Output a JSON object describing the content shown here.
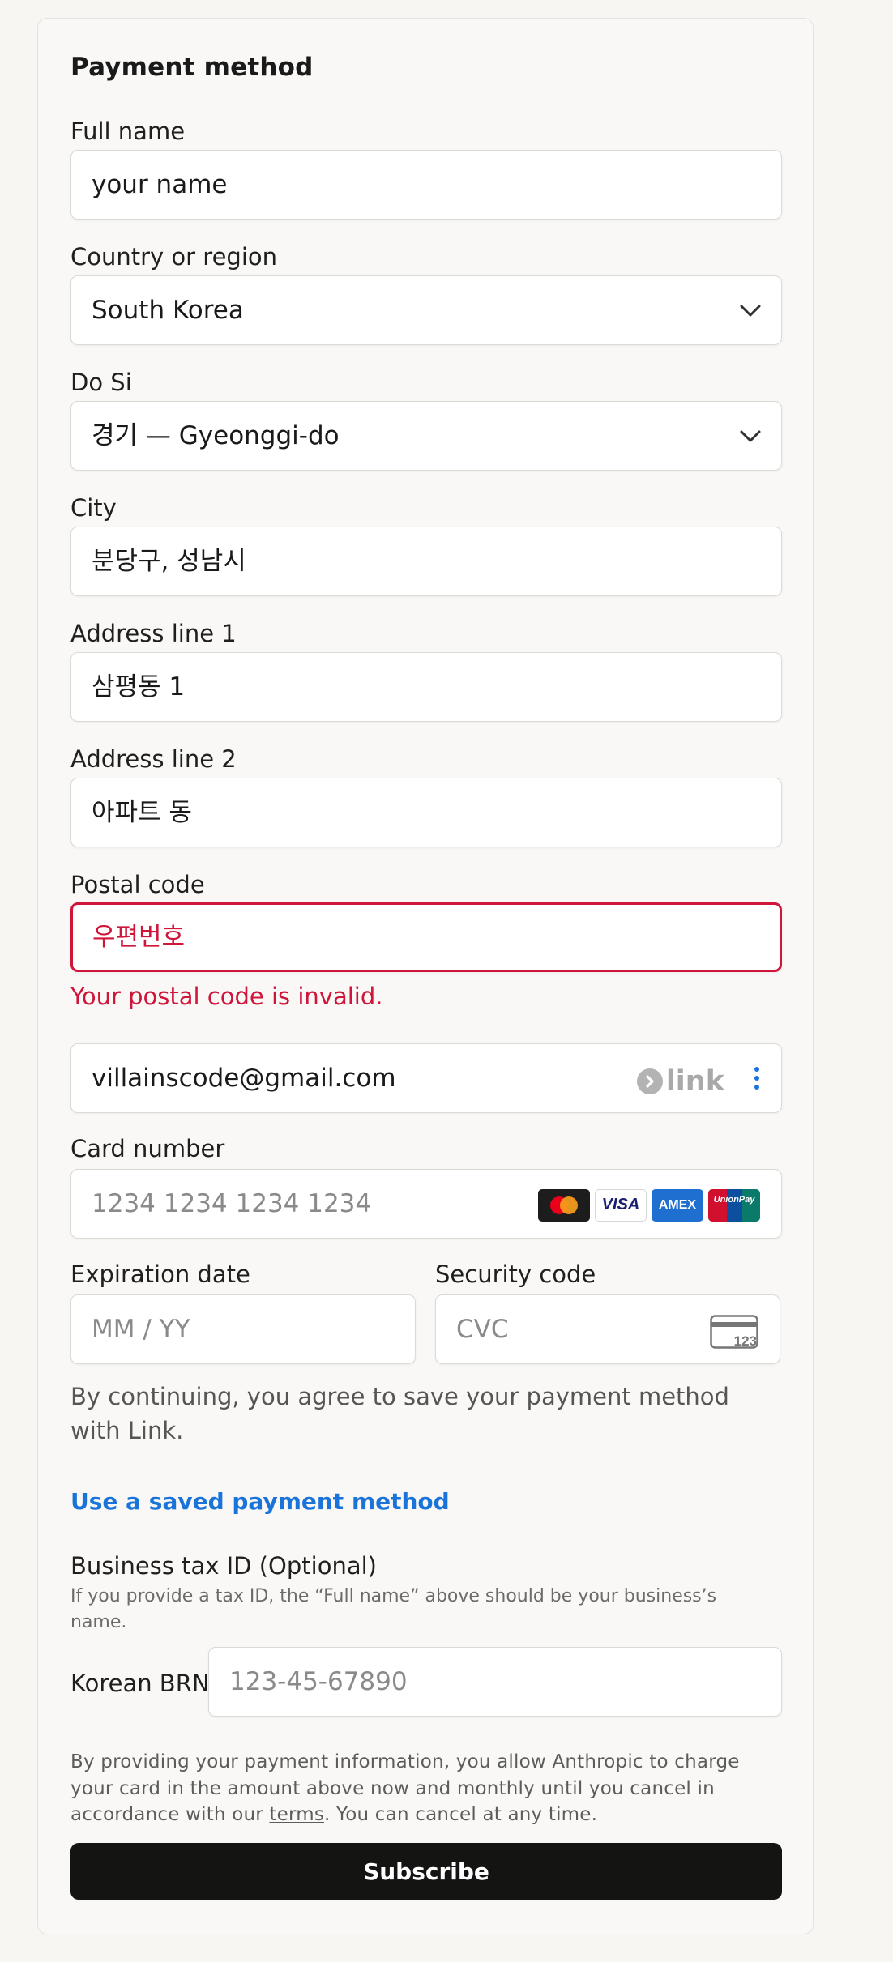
{
  "title": "Payment method",
  "full_name": {
    "label": "Full name",
    "value": "your name"
  },
  "country": {
    "label": "Country or region",
    "value": "South Korea"
  },
  "do_si": {
    "label": "Do Si",
    "value": "경기 — Gyeonggi-do"
  },
  "city": {
    "label": "City",
    "value": "분당구, 성남시"
  },
  "address1": {
    "label": "Address line 1",
    "value": "삼평동 1"
  },
  "address2": {
    "label": "Address line 2",
    "value": "아파트 동"
  },
  "postal": {
    "label": "Postal code",
    "value": "우편번호",
    "error": "Your postal code is invalid."
  },
  "link_email": {
    "value": "villainscode@gmail.com",
    "logo_text": "link"
  },
  "card_number": {
    "label": "Card number",
    "placeholder": "1234 1234 1234 1234",
    "brands": [
      "Mastercard",
      "VISA",
      "AMEX",
      "UnionPay"
    ]
  },
  "expiration": {
    "label": "Expiration date",
    "placeholder": "MM / YY"
  },
  "security": {
    "label": "Security code",
    "placeholder": "CVC",
    "icon_text": "123"
  },
  "link_consent": "By continuing, you agree to save your payment method with Link.",
  "saved_method_link": "Use a saved payment method",
  "tax": {
    "label": "Business tax ID (Optional)",
    "hint": "If you provide a tax ID, the “Full name” above should be your business’s name.",
    "type_label": "Korean BRN",
    "placeholder": "123-45-67890"
  },
  "legal": {
    "before": "By providing your payment information, you allow Anthropic to charge your card in the amount above now and monthly until you cancel in accordance with our ",
    "link": "terms",
    "after": ". You can cancel at any time."
  },
  "subscribe_label": "Subscribe",
  "colors": {
    "error": "#d0153b",
    "link": "#1a73d9",
    "button": "#141413"
  }
}
